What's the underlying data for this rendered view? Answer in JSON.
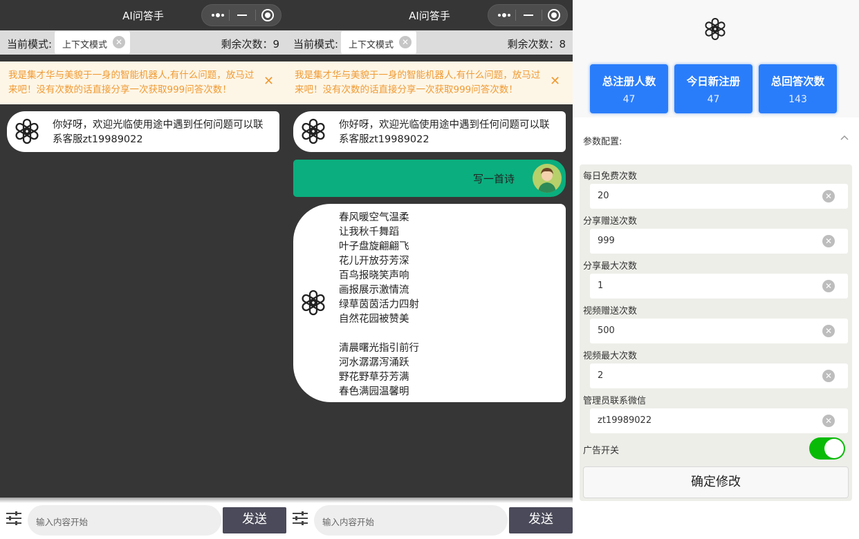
{
  "phones": [
    {
      "title": "AI问答手",
      "mode_label": "当前模式:",
      "mode_chip": "上下文模式",
      "remaining": "剩余次数：9",
      "notice": "我是集才华与美貌于一身的智能机器人,有什么问题，放马过来吧！没有次数的话直接分享一次获取999问答次数！",
      "welcome": "你好呀，欢迎光临使用途中遇到任何问题可以联系客服zt19989022",
      "input_placeholder": "输入内容开始",
      "send_label": "发送"
    },
    {
      "title": "AI问答手",
      "mode_label": "当前模式:",
      "mode_chip": "上下文模式",
      "remaining": "剩余次数：8",
      "notice": "我是集才华与美貌于一身的智能机器人,有什么问题，放马过来吧！没有次数的话直接分享一次获取999问答次数！",
      "welcome": "你好呀，欢迎光临使用途中遇到任何问题可以联系客服zt19989022",
      "user_message": "写一首诗",
      "poem": "春风暖空气温柔\n让我秋千舞蹈\n叶子盘旋翩翩飞\n花儿开放芬芳深\n百鸟报晓笑声响\n画报展示激情流\n绿草茵茵活力四射\n自然花园被赞美\n\n清晨曙光指引前行\n河水潺潺泻涌跃\n野花野草芬芳满\n春色满园温馨明",
      "input_placeholder": "输入内容开始",
      "send_label": "发送"
    }
  ],
  "admin": {
    "stats": [
      {
        "label": "总注册人数",
        "value": "47"
      },
      {
        "label": "今日新注册",
        "value": "47"
      },
      {
        "label": "总回答次数",
        "value": "143"
      }
    ],
    "config_title": "参数配置:",
    "fields": [
      {
        "label": "每日免费次数",
        "value": "20"
      },
      {
        "label": "分享赠送次数",
        "value": "999"
      },
      {
        "label": "分享最大次数",
        "value": "1"
      },
      {
        "label": "视频赠送次数",
        "value": "500"
      },
      {
        "label": "视频最大次数",
        "value": "2"
      },
      {
        "label": "管理员联系微信",
        "value": "zt19989022"
      }
    ],
    "ad_switch_label": "广告开关",
    "ad_switch_on": true,
    "confirm_label": "确定修改"
  },
  "colors": {
    "phone_bg": "#363636",
    "user_bubble": "#0bae7e",
    "stat_blue": "#2a7dfa",
    "notice_text": "#f09a33",
    "toggle_on": "#09bb07"
  },
  "icons": [
    "more-dots-icon",
    "minimize-icon",
    "close-target-icon",
    "openai-logo-icon",
    "clear-icon",
    "settings-sliders-icon",
    "user-avatar-icon",
    "chevron-up-icon"
  ]
}
